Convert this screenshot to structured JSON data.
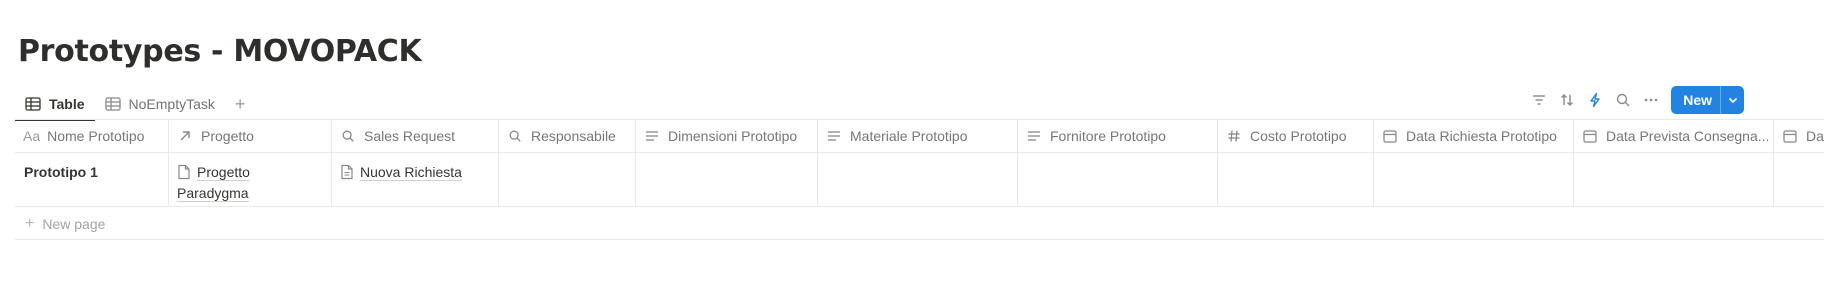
{
  "page": {
    "title": "Prototypes - MOVOPACK"
  },
  "views": {
    "tabs": [
      {
        "label": "Table",
        "icon": "table-icon",
        "active": true
      },
      {
        "label": "NoEmptyTask",
        "icon": "table-icon",
        "active": false
      }
    ],
    "add_icon": "plus-icon"
  },
  "toolbar": {
    "icons": [
      "filter-icon",
      "sort-icon",
      "lightning-icon",
      "search-icon",
      "more-icon"
    ],
    "new_label": "New",
    "accent": "#2383e2"
  },
  "table": {
    "columns": [
      {
        "label": "Nome Prototipo",
        "icon": "Aa"
      },
      {
        "label": "Progetto",
        "icon": "arrow-up-right-icon"
      },
      {
        "label": "Sales Request",
        "icon": "search-icon"
      },
      {
        "label": "Responsabile",
        "icon": "search-icon"
      },
      {
        "label": "Dimensioni Prototipo",
        "icon": "text-lines-icon"
      },
      {
        "label": "Materiale Prototipo",
        "icon": "text-lines-icon"
      },
      {
        "label": "Fornitore Prototipo",
        "icon": "text-lines-icon"
      },
      {
        "label": "Costo Prototipo",
        "icon": "hash-icon"
      },
      {
        "label": "Data Richiesta Prototipo",
        "icon": "calendar-icon"
      },
      {
        "label": "Data Prevista Consegna...",
        "icon": "calendar-icon"
      },
      {
        "label": "Da",
        "icon": "calendar-icon"
      }
    ],
    "rows": [
      {
        "nome": "Prototipo 1",
        "progetto_line1": "Progetto",
        "progetto_line2": "Paradygma",
        "sales_request": "Nuova Richiesta"
      }
    ]
  },
  "new_page_label": "New page"
}
